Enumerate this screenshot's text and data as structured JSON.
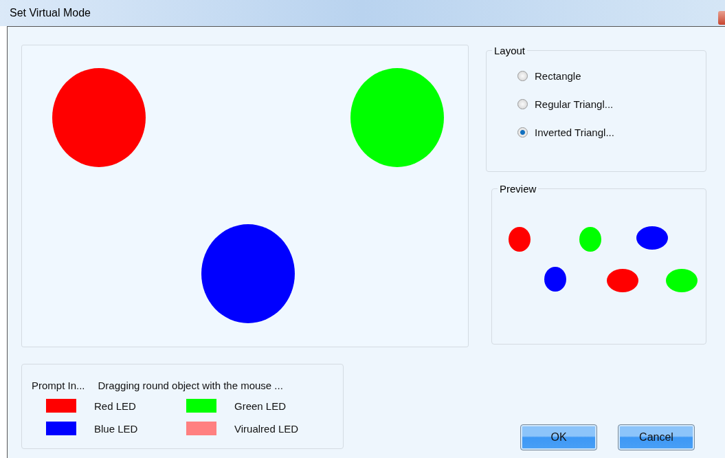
{
  "window": {
    "title": "Set Virtual Mode"
  },
  "canvas": {
    "leds": [
      {
        "color": "#ff0000"
      },
      {
        "color": "#00ff00"
      },
      {
        "color": "#0000ff"
      }
    ]
  },
  "layout": {
    "title": "Layout",
    "options": [
      {
        "label": "Rectangle",
        "selected": false
      },
      {
        "label": "Regular Triangl...",
        "selected": false
      },
      {
        "label": "Inverted Triangl...",
        "selected": true
      }
    ]
  },
  "preview": {
    "title": "Preview",
    "leds": [
      {
        "color": "#ff0000"
      },
      {
        "color": "#00ff00"
      },
      {
        "color": "#0000ff"
      },
      {
        "color": "#0000ff"
      },
      {
        "color": "#ff0000"
      },
      {
        "color": "#00ff00"
      }
    ]
  },
  "prompt": {
    "label": "Prompt In...",
    "message": "Dragging round object with the mouse ...",
    "legend": [
      {
        "label": "Red LED",
        "color": "#ff0000"
      },
      {
        "label": "Green LED",
        "color": "#00ff00"
      },
      {
        "label": "Blue LED",
        "color": "#0000ff"
      },
      {
        "label": "Virualred LED",
        "color": "#ff8080"
      }
    ]
  },
  "buttons": [
    "OK",
    "Cancel"
  ]
}
